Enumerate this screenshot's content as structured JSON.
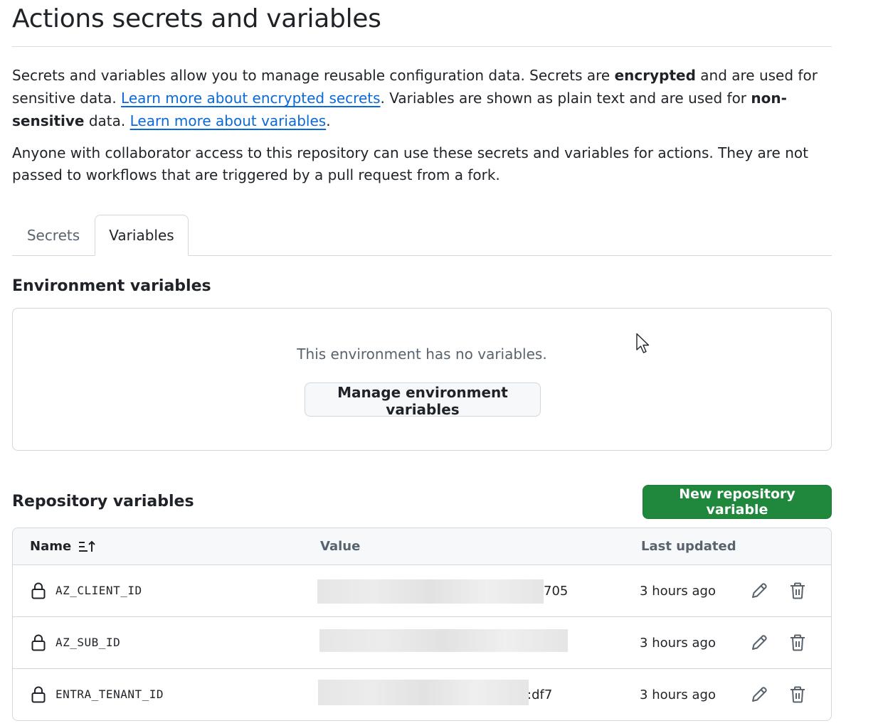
{
  "header": {
    "title": "Actions secrets and variables"
  },
  "intro": {
    "p1_part1": "Secrets and variables allow you to manage reusable configuration data. Secrets are ",
    "p1_bold1": "encrypted",
    "p1_part2": " and are used for sensitive data. ",
    "p1_link1": "Learn more about encrypted secrets",
    "p1_part3": ". Variables are shown as plain text and are used for ",
    "p1_bold2": "non-sensitive",
    "p1_part4": " data. ",
    "p1_link2": "Learn more about variables",
    "p1_part5": ".",
    "p2": "Anyone with collaborator access to this repository can use these secrets and variables for actions. They are not passed to workflows that are triggered by a pull request from a fork."
  },
  "tabs": [
    {
      "label": "Secrets",
      "selected": false
    },
    {
      "label": "Variables",
      "selected": true
    }
  ],
  "environment": {
    "heading": "Environment variables",
    "empty_text": "This environment has no variables.",
    "manage_button": "Manage environment variables"
  },
  "repository": {
    "heading": "Repository variables",
    "new_button": "New repository variable",
    "columns": {
      "name": "Name",
      "value": "Value",
      "last_updated": "Last updated"
    },
    "rows": [
      {
        "name": "AZ_CLIENT_ID",
        "value_visible": "705",
        "last_updated": "3 hours ago"
      },
      {
        "name": "AZ_SUB_ID",
        "value_visible": "",
        "last_updated": "3 hours ago"
      },
      {
        "name": "ENTRA_TENANT_ID",
        "value_visible": ":df7",
        "last_updated": "3 hours ago"
      }
    ]
  },
  "icons": {
    "sort": "sort-ascending-icon",
    "lock": "lock-icon",
    "edit": "pencil-icon",
    "delete": "trash-icon",
    "cursor": "mouse-pointer-icon"
  },
  "colors": {
    "link": "#0969da",
    "primary_button": "#1f883d",
    "text": "#1f2328",
    "muted_text": "#59636e",
    "border": "#d0d7de"
  }
}
